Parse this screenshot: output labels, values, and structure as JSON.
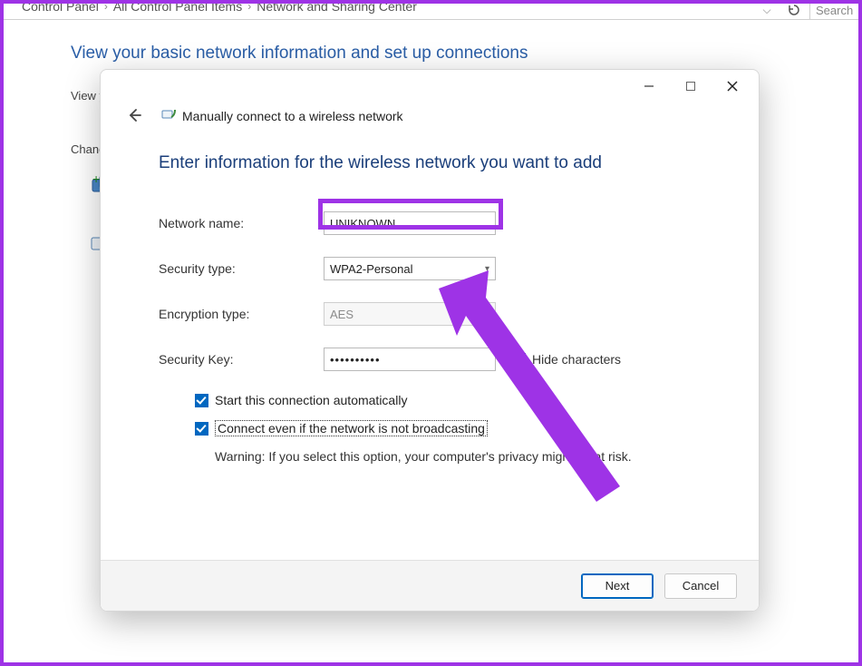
{
  "breadcrumb": {
    "items": [
      "Control Panel",
      "All Control Panel Items",
      "Network and Sharing Center"
    ],
    "search_placeholder": "Search"
  },
  "cpanel": {
    "heading": "View your basic network information and set up connections",
    "section1": "View you",
    "section2": "Change"
  },
  "dialog": {
    "title": "Manually connect to a wireless network",
    "heading": "Enter information for the wireless network you want to add",
    "labels": {
      "network_name": "Network name:",
      "security_type": "Security type:",
      "encryption_type": "Encryption type:",
      "security_key": "Security Key:",
      "hide_characters": "Hide characters",
      "start_auto": "Start this connection automatically",
      "connect_not_broadcast": "Connect even if the network is not broadcasting",
      "warning": "Warning: If you select this option, your computer's privacy might be at risk."
    },
    "values": {
      "network_name": "UNIKNOWN",
      "security_type": "WPA2-Personal",
      "encryption_type": "AES",
      "security_key": "••••••••••"
    },
    "checkboxes": {
      "hide_characters": true,
      "start_auto": true,
      "connect_not_broadcast": true
    },
    "buttons": {
      "next": "Next",
      "cancel": "Cancel"
    }
  }
}
